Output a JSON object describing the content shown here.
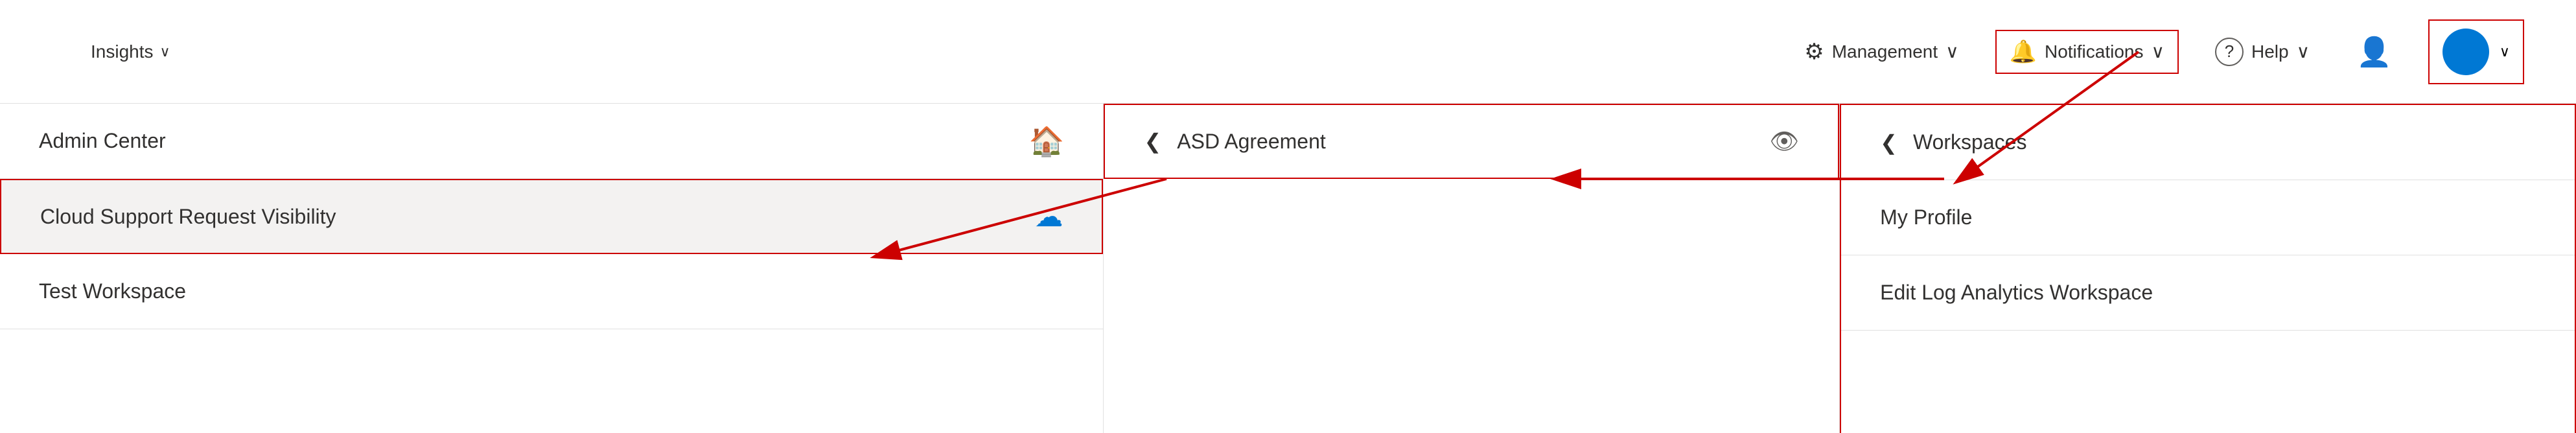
{
  "topbar": {
    "insights_label": "Insights",
    "management_label": "Management",
    "notifications_label": "Notifications",
    "help_label": "Help",
    "chevron": "∨"
  },
  "left_panel": {
    "admin_center_label": "Admin Center",
    "cloud_support_label": "Cloud Support Request Visibility",
    "test_workspace_label": "Test Workspace"
  },
  "middle_panel": {
    "asd_label": "ASD Agreement"
  },
  "right_panel": {
    "workspaces_label": "Workspaces",
    "my_profile_label": "My Profile",
    "edit_workspace_label": "Edit Log Analytics Workspace"
  }
}
